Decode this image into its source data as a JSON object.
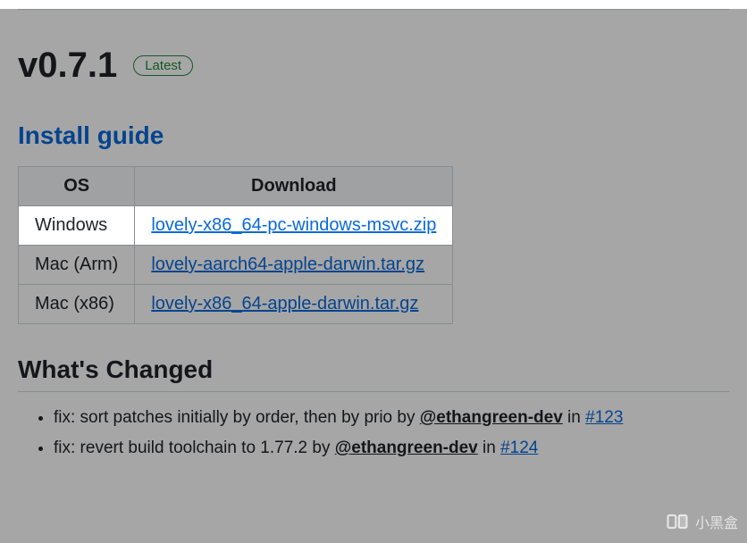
{
  "version": "v0.7.1",
  "badge": "Latest",
  "install_guide_label": "Install guide",
  "table": {
    "headers": {
      "os": "OS",
      "download": "Download"
    },
    "rows": [
      {
        "os": "Windows",
        "download": "lovely-x86_64-pc-windows-msvc.zip",
        "highlight": true
      },
      {
        "os": "Mac (Arm)",
        "download": "lovely-aarch64-apple-darwin.tar.gz",
        "highlight": false
      },
      {
        "os": "Mac (x86)",
        "download": "lovely-x86_64-apple-darwin.tar.gz",
        "highlight": false
      }
    ]
  },
  "changed_heading": "What's Changed",
  "changes": [
    {
      "prefix": "fix: sort patches initially by order, then by prio by ",
      "author": "@ethangreen-dev",
      "mid": " in ",
      "pr": "#123"
    },
    {
      "prefix": "fix: revert build toolchain to 1.77.2 by ",
      "author": "@ethangreen-dev",
      "mid": " in ",
      "pr": "#124"
    }
  ],
  "watermark": "小黑盒"
}
